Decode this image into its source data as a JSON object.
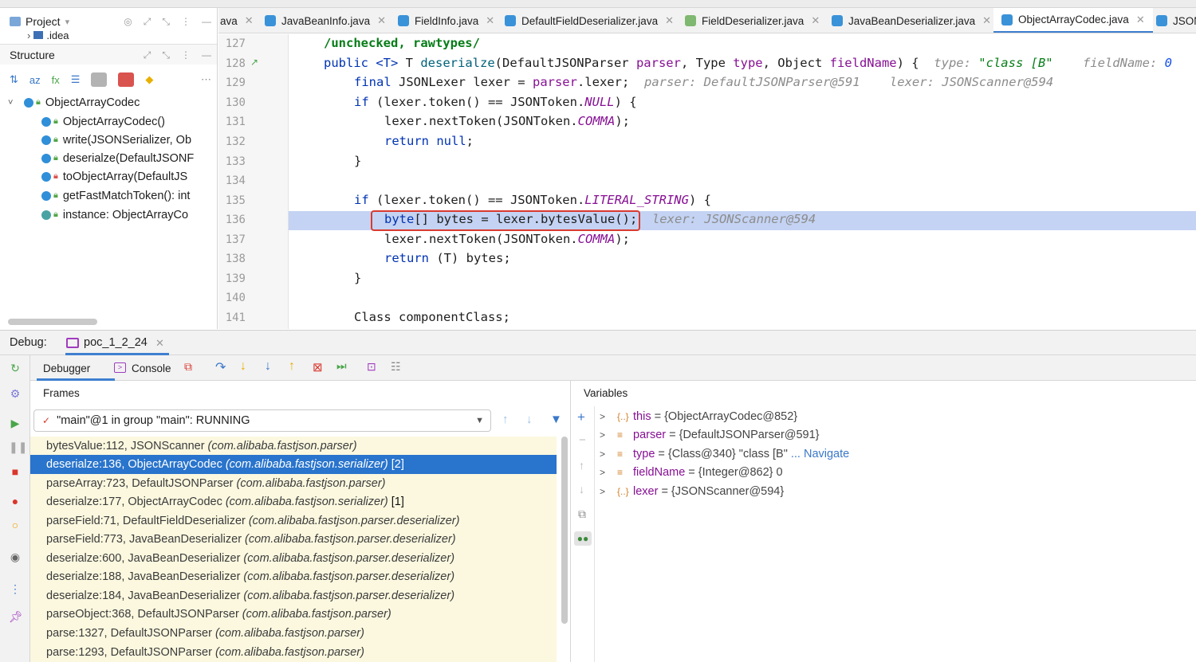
{
  "left_panel": {
    "project_label": "Project",
    "idea_label": ".idea",
    "structure_label": "Structure",
    "tree": [
      {
        "label": "ObjectArrayCodec",
        "lock": "green"
      },
      {
        "label": "ObjectArrayCodec()",
        "lock": "green"
      },
      {
        "label": "write(JSONSerializer, Ob",
        "lock": "green"
      },
      {
        "label": "deserialze(DefaultJSONF",
        "lock": "green"
      },
      {
        "label": "toObjectArray(DefaultJS",
        "lock": "red"
      },
      {
        "label": "getFastMatchToken(): int",
        "lock": "green"
      },
      {
        "label": "instance: ObjectArrayCo",
        "lock": "green"
      }
    ]
  },
  "tabs": [
    {
      "label": "ava"
    },
    {
      "label": "JavaBeanInfo.java"
    },
    {
      "label": "FieldInfo.java"
    },
    {
      "label": "DefaultFieldDeserializer.java"
    },
    {
      "label": "FieldDeserializer.java"
    },
    {
      "label": "JavaBeanDeserializer.java"
    },
    {
      "label": "ObjectArrayCodec.java"
    },
    {
      "label": "JSON"
    }
  ],
  "editor": {
    "line_numbers": [
      "127",
      "128",
      "129",
      "130",
      "131",
      "132",
      "133",
      "134",
      "135",
      "136",
      "137",
      "138",
      "139",
      "140",
      "141"
    ],
    "lines": {
      "l127": "/unchecked, rawtypes/",
      "l128_a": "public ",
      "l128_b": "<T>",
      "l128_c": " T ",
      "l128_d": "deserialze",
      "l128_e": "(DefaultJSONParser ",
      "l128_f": "parser",
      "l128_g": ", Type ",
      "l128_h": "type",
      "l128_i": ", Object ",
      "l128_j": "fieldName",
      "l128_k": ") {",
      "l128_hint1": "type: ",
      "l128_hint2": "\"class [B\"",
      "l128_hint3": "fieldName: ",
      "l128_hint4": "0",
      "l129_a": "final ",
      "l129_b": "JSONLexer lexer = ",
      "l129_c": "parser",
      "l129_d": ".lexer;",
      "l129_hint": "parser: DefaultJSONParser@591    lexer: JSONScanner@594",
      "l130_a": "if ",
      "l130_b": "(lexer.token() == JSONToken.",
      "l130_c": "NULL",
      "l130_d": ") {",
      "l131_a": "lexer.nextToken(JSONToken.",
      "l131_b": "COMMA",
      "l131_c": ");",
      "l132_a": "return null",
      "l132_b": ";",
      "l133": "}",
      "l135_a": "if ",
      "l135_b": "(lexer.token() == JSONToken.",
      "l135_c": "LITERAL_STRING",
      "l135_d": ") {",
      "l136_a": "byte",
      "l136_b": "[] bytes = lexer.bytesValue();",
      "l136_hint": "lexer: JSONScanner@594",
      "l137_a": "lexer.nextToken(JSONToken.",
      "l137_b": "COMMA",
      "l137_c": ");",
      "l138_a": "return ",
      "l138_b": "(T) bytes;",
      "l139": "}",
      "l141": "Class componentClass;"
    }
  },
  "debug": {
    "label": "Debug:",
    "session": "poc_1_2_24",
    "debugger_tab": "Debugger",
    "console_tab": "Console",
    "frames_label": "Frames",
    "variables_label": "Variables",
    "thread": "\"main\"@1 in group \"main\": RUNNING",
    "frames": [
      {
        "method": "bytesValue:112, JSONScanner",
        "pkg": "(com.alibaba.fastjson.parser)",
        "tag": ""
      },
      {
        "method": "deserialze:136, ObjectArrayCodec",
        "pkg": "(com.alibaba.fastjson.serializer)",
        "tag": "[2]"
      },
      {
        "method": "parseArray:723, DefaultJSONParser",
        "pkg": "(com.alibaba.fastjson.parser)",
        "tag": ""
      },
      {
        "method": "deserialze:177, ObjectArrayCodec",
        "pkg": "(com.alibaba.fastjson.serializer)",
        "tag": "[1]"
      },
      {
        "method": "parseField:71, DefaultFieldDeserializer",
        "pkg": "(com.alibaba.fastjson.parser.deserializer)",
        "tag": ""
      },
      {
        "method": "parseField:773, JavaBeanDeserializer",
        "pkg": "(com.alibaba.fastjson.parser.deserializer)",
        "tag": ""
      },
      {
        "method": "deserialze:600, JavaBeanDeserializer",
        "pkg": "(com.alibaba.fastjson.parser.deserializer)",
        "tag": ""
      },
      {
        "method": "deserialze:188, JavaBeanDeserializer",
        "pkg": "(com.alibaba.fastjson.parser.deserializer)",
        "tag": ""
      },
      {
        "method": "deserialze:184, JavaBeanDeserializer",
        "pkg": "(com.alibaba.fastjson.parser.deserializer)",
        "tag": ""
      },
      {
        "method": "parseObject:368, DefaultJSONParser",
        "pkg": "(com.alibaba.fastjson.parser)",
        "tag": ""
      },
      {
        "method": "parse:1327, DefaultJSONParser",
        "pkg": "(com.alibaba.fastjson.parser)",
        "tag": ""
      },
      {
        "method": "parse:1293, DefaultJSONParser",
        "pkg": "(com.alibaba.fastjson.parser)",
        "tag": ""
      }
    ],
    "variables": [
      {
        "icon": "{..}",
        "name": "this",
        "value": "= {ObjectArrayCodec@852}",
        "extra": ""
      },
      {
        "icon": "≡",
        "name": "parser",
        "value": "= {DefaultJSONParser@591}",
        "extra": ""
      },
      {
        "icon": "≡",
        "name": "type",
        "value": "= {Class@340} \"class [B\"",
        "extra": "... Navigate"
      },
      {
        "icon": "≡",
        "name": "fieldName",
        "value": "= {Integer@862} 0",
        "extra": ""
      },
      {
        "icon": "{..}",
        "name": "lexer",
        "value": "= {JSONScanner@594}",
        "extra": ""
      }
    ]
  },
  "colors": {
    "selection": "#2974cc",
    "frame_bg": "#fbf8df",
    "exec_line": "#c4d3f3",
    "red_box": "#d93a30"
  }
}
